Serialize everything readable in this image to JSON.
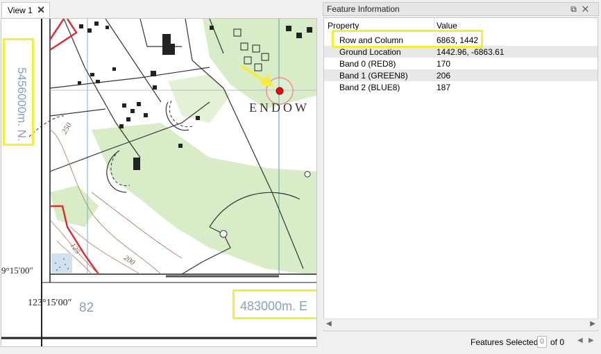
{
  "view_tab": {
    "label": "View 1",
    "close_glyph": "✕"
  },
  "map": {
    "northing_label": "5456000m. N.",
    "easting_label": "483000m. E",
    "grid_number": "82",
    "place_label": "ENDOW",
    "longitude_label": "123°15′00″",
    "latitude_label": "9°15′00″",
    "contour_labels": [
      "250",
      "125",
      "200"
    ],
    "marker_icon": "red-point-marker",
    "arrow_icon": "yellow-arrow"
  },
  "panel": {
    "title": "Feature Information",
    "controls": [
      "restore-icon",
      "close-icon"
    ],
    "columns": {
      "property": "Property",
      "value": "Value"
    },
    "rows": [
      {
        "property": "Row and Column",
        "value": "6863, 1442"
      },
      {
        "property": "Ground Location",
        "value": "1442.96, -6863.61"
      },
      {
        "property": "Band 0 (RED8)",
        "value": "170"
      },
      {
        "property": "Band 1 (GREEN8)",
        "value": "206"
      },
      {
        "property": "Band 2 (BLUE8)",
        "value": "187"
      }
    ],
    "status": {
      "features_selected_label": "Features Selected:",
      "selected_value": "0",
      "of_text": "of 0"
    }
  },
  "colors": {
    "highlight": "#f3ee3d",
    "marker": "#e01010",
    "vegetation": "#d9ecc8",
    "road_red": "#d83030"
  }
}
